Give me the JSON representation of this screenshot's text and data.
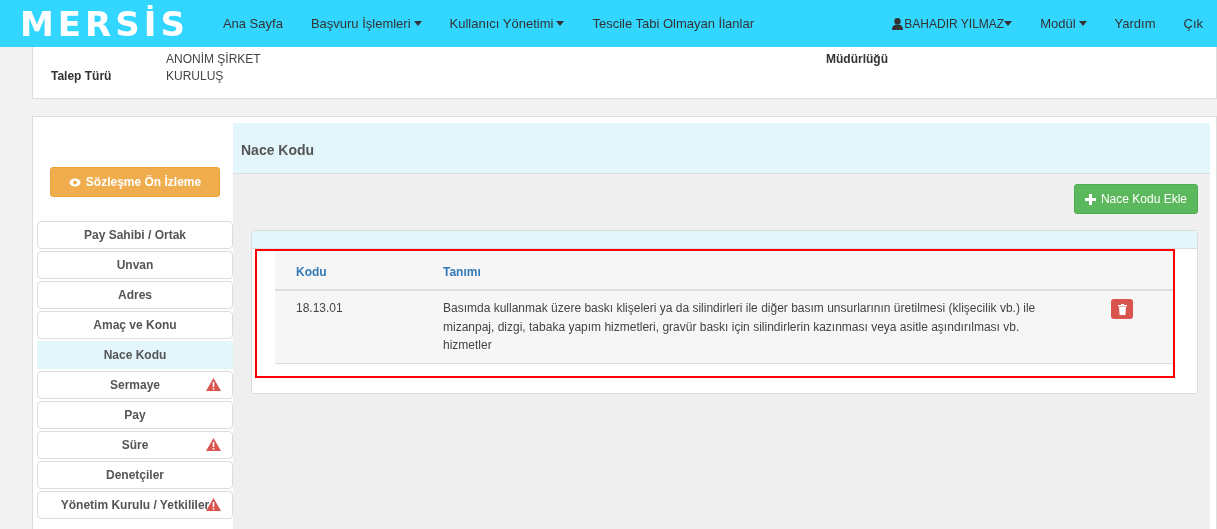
{
  "navbar": {
    "logo": "MERSİS",
    "items": [
      {
        "label": "Ana Sayfa",
        "dropdown": false
      },
      {
        "label": "Başvuru İşlemleri",
        "dropdown": true
      },
      {
        "label": "Kullanıcı Yönetimi",
        "dropdown": true
      },
      {
        "label": "Tescile Tabi Olmayan İlanlar",
        "dropdown": false
      }
    ],
    "right_items": [
      {
        "label": "BAHADIR YILMAZ",
        "dropdown": true,
        "kind": "user"
      },
      {
        "label": "Modül",
        "dropdown": true,
        "kind": "plain"
      },
      {
        "label": "Yardım",
        "dropdown": false,
        "kind": "plain"
      },
      {
        "label": "Çık",
        "dropdown": false,
        "kind": "plain"
      }
    ]
  },
  "info": {
    "left": [
      {
        "value": "ANONİM ŞİRKET"
      },
      {
        "label": "Talep Türü",
        "value": "KURULUŞ"
      }
    ],
    "right_label": "Müdürlüğü"
  },
  "preview_button": "Sözleşme Ön İzleme",
  "sidebar": {
    "items": [
      {
        "label": "Pay Sahibi / Ortak",
        "selected": false,
        "warning": false
      },
      {
        "label": "Unvan",
        "selected": false,
        "warning": false
      },
      {
        "label": "Adres",
        "selected": false,
        "warning": false
      },
      {
        "label": "Amaç ve Konu",
        "selected": false,
        "warning": false
      },
      {
        "label": "Nace Kodu",
        "selected": true,
        "warning": false
      },
      {
        "label": "Sermaye",
        "selected": false,
        "warning": true
      },
      {
        "label": "Pay",
        "selected": false,
        "warning": false
      },
      {
        "label": "Süre",
        "selected": false,
        "warning": true
      },
      {
        "label": "Denetçiler",
        "selected": false,
        "warning": false
      },
      {
        "label": "Yönetim Kurulu / Yetkililer",
        "selected": false,
        "warning": true
      }
    ]
  },
  "panel": {
    "title": "Nace Kodu",
    "add_button": "Nace Kodu Ekle",
    "table": {
      "columns": [
        "Kodu",
        "Tanımı"
      ],
      "rows": [
        {
          "code": "18.13.01",
          "description": "Basımda kullanmak üzere baskı klişeleri ya da silindirleri ile diğer basım unsurlarının üretilmesi (klişecilik vb.) ile mizanpaj, dizgi, tabaka yapım hizmetleri, gravür baskı için silindirlerin kazınması veya asitle aşındırılması vb. hizmetler"
        }
      ]
    }
  }
}
